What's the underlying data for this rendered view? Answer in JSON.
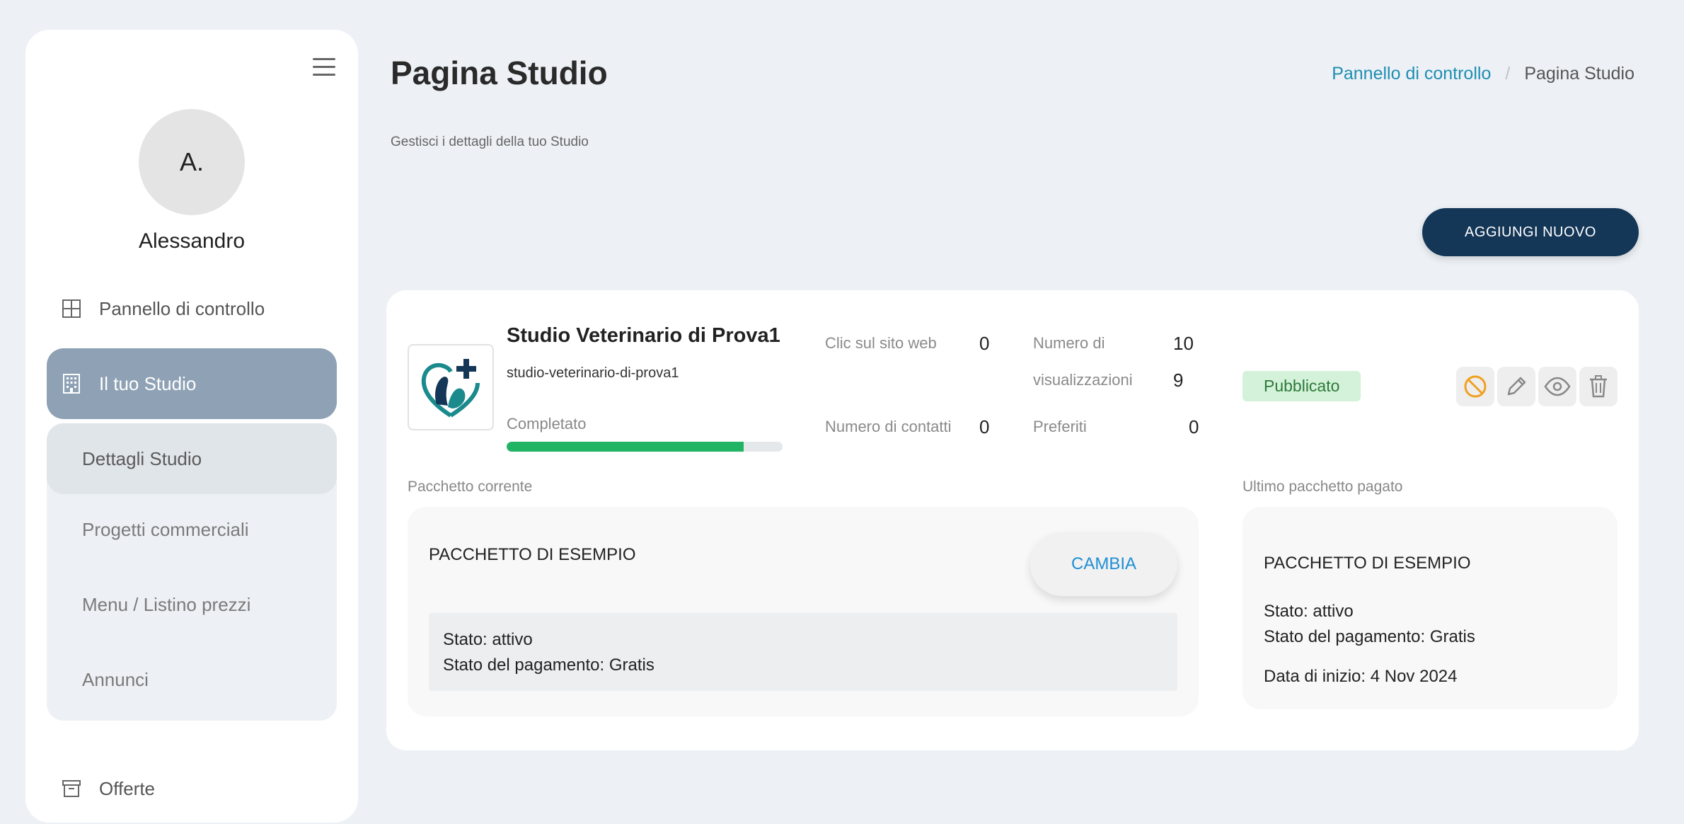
{
  "sidebar": {
    "avatar_initials": "A.",
    "username": "Alessandro",
    "nav": {
      "dashboard": "Pannello di controllo",
      "studio": "Il tuo Studio",
      "offers": "Offerte"
    },
    "submenu": [
      "Dettagli Studio",
      "Progetti commerciali",
      "Menu / Listino prezzi",
      "Annunci"
    ]
  },
  "header": {
    "title": "Pagina Studio",
    "subtitle": "Gestisci i dettagli della tuo Studio",
    "breadcrumb": {
      "parent": "Pannello di controllo",
      "separator": "/",
      "current": "Pagina Studio"
    },
    "add_button": "AGGIUNGI NUOVO"
  },
  "studio": {
    "name": "Studio Veterinario di Prova1",
    "slug": "studio-veterinario-di-prova1",
    "progress_label": "Completato",
    "progress_percent": 86,
    "stats": {
      "web_clicks_label": "Clic sul sito web",
      "web_clicks": "0",
      "views_label_1": "Numero di",
      "views_label_2": "visualizzazioni",
      "views_value_1": "10",
      "views_value_2": "9",
      "contacts_label": "Numero di contatti",
      "contacts": "0",
      "favorites_label": "Preferiti",
      "favorites": "0"
    },
    "status_badge": "Pubblicato"
  },
  "current_package": {
    "section_label": "Pacchetto corrente",
    "name": "PACCHETTO DI ESEMPIO",
    "change_button": "CAMBIA",
    "status": "Stato: attivo",
    "payment_status": "Stato del pagamento: Gratis"
  },
  "last_package": {
    "section_label": "Ultimo pacchetto pagato",
    "name": "PACCHETTO DI ESEMPIO",
    "status": "Stato: attivo",
    "payment_status": "Stato del pagamento: Gratis",
    "start_date": "Data di inizio: 4 Nov 2024"
  },
  "colors": {
    "primary_dark": "#143657",
    "link": "#1f8eb3",
    "active_nav": "#8ea1b5",
    "progress": "#20b464",
    "badge_bg": "#d4f2d9",
    "badge_text": "#2d7a3a",
    "disable_icon": "#f0a020"
  },
  "icons": {
    "menu": "hamburger-icon",
    "dashboard": "grid-icon",
    "studio": "building-icon",
    "offers": "archive-icon",
    "disable": "ban-icon",
    "edit": "pencil-icon",
    "view": "eye-icon",
    "delete": "trash-icon"
  }
}
